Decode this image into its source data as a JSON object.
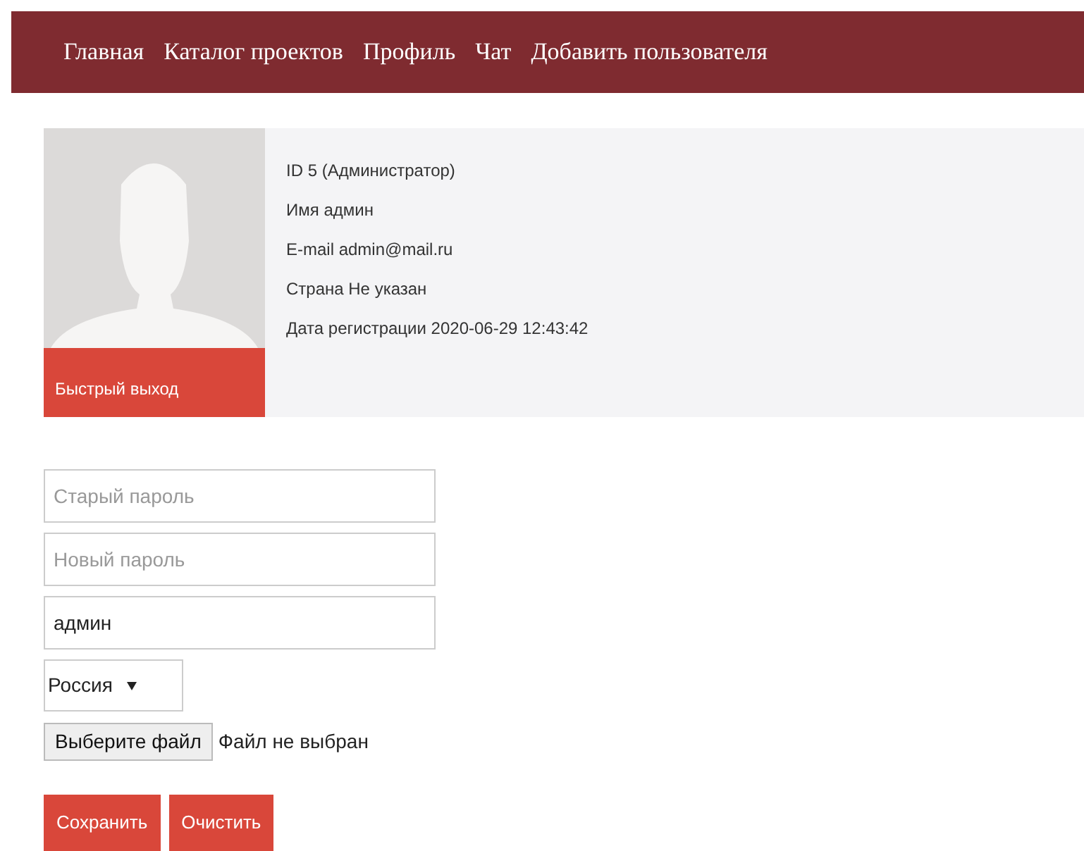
{
  "nav": {
    "items": [
      {
        "label": "Главная"
      },
      {
        "label": "Каталог проектов"
      },
      {
        "label": "Профиль"
      },
      {
        "label": "Чат"
      },
      {
        "label": "Добавить пользователя"
      }
    ]
  },
  "profile": {
    "quick_exit": "Быстрый выход",
    "lines": [
      "ID 5 (Администратор)",
      "Имя админ",
      "E-mail admin@mail.ru",
      "Страна Не указан",
      "Дата регистрации 2020-06-29 12:43:42"
    ]
  },
  "form": {
    "fields": [
      {
        "placeholder": "Старый пароль"
      },
      {
        "placeholder": "Новый пароль"
      },
      {
        "value": "админ"
      }
    ],
    "country": "Россия",
    "file_button": "Выберите файл",
    "file_status": "Файл не выбран",
    "buttons": [
      "Сохранить",
      "Очистить"
    ]
  }
}
